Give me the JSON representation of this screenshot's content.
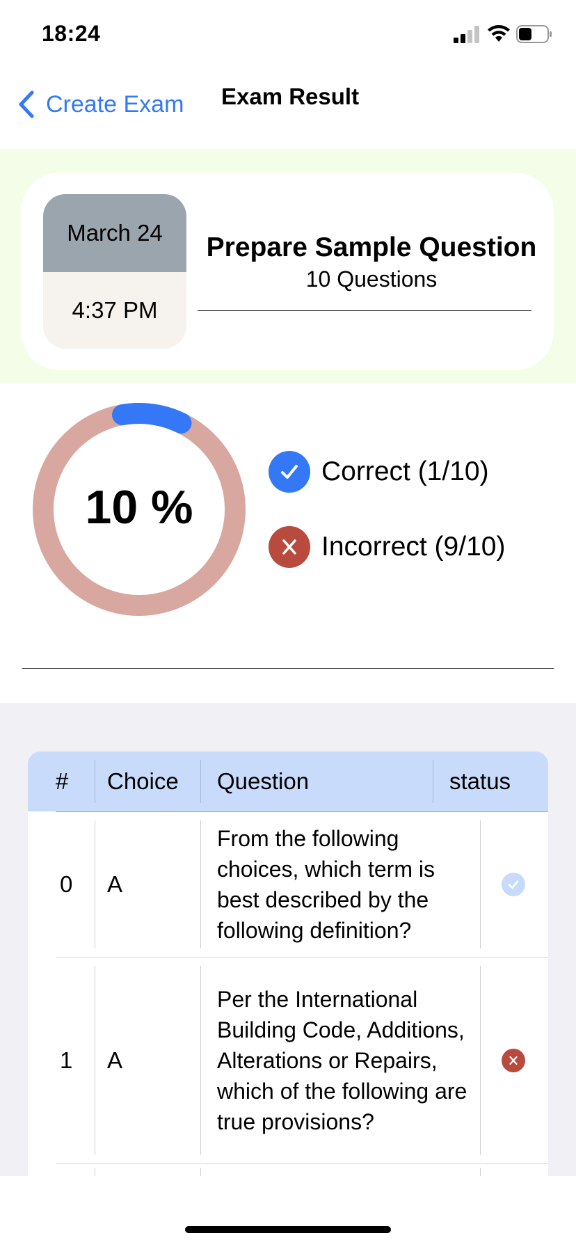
{
  "status_bar": {
    "time": "18:24"
  },
  "nav": {
    "back_label": "Create Exam",
    "title": "Exam Result"
  },
  "exam": {
    "date": "March 24",
    "time": "4:37 PM",
    "name": "Prepare Sample Question",
    "question_count": "10 Questions"
  },
  "score": {
    "percent_label": "10 %",
    "fraction": 0.1,
    "correct_label": "Correct (1/10)",
    "incorrect_label": "Incorrect (9/10)"
  },
  "colors": {
    "accent": "#3478f6",
    "correct": "#3478f6",
    "incorrect": "#b84a3e",
    "ring_track": "#d8a8a0",
    "header_band": "#f4fde7"
  },
  "table": {
    "columns": [
      "#",
      "Choice",
      "Question",
      "status"
    ],
    "rows": [
      {
        "num": "0",
        "choice": "A",
        "question": "From the following choices, which term is best described by the following definition?",
        "status": "correct"
      },
      {
        "num": "1",
        "choice": "A",
        "question": "Per the International Building Code, Additions, Alterations or Repairs, which of the following are true provisions?",
        "status": "incorrect"
      }
    ]
  }
}
